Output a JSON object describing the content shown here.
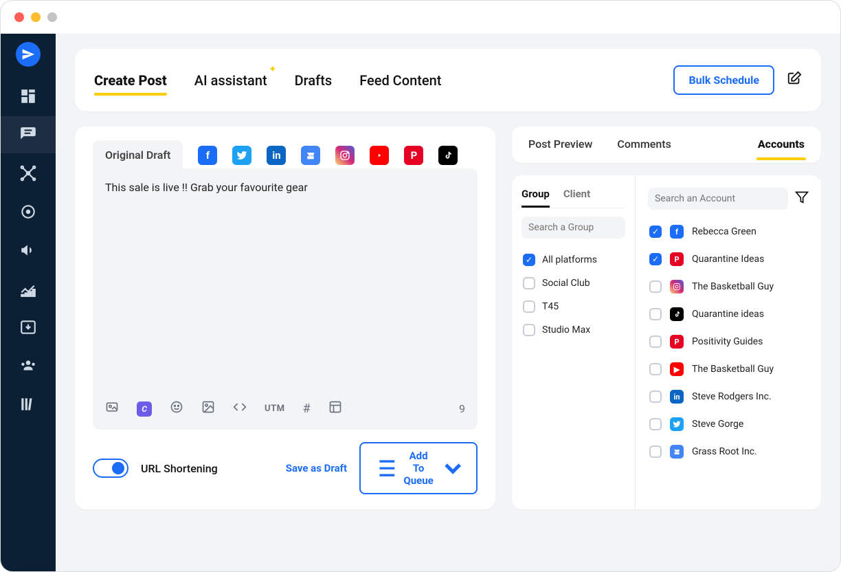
{
  "topTabs": {
    "create": "Create Post",
    "ai": "AI assistant",
    "drafts": "Drafts",
    "feed": "Feed Content"
  },
  "bulkSchedule": "Bulk Schedule",
  "editor": {
    "draftTab": "Original Draft",
    "text": "This sale is live !! Grab your favourite gear",
    "charCount": "9",
    "utmLabel": "UTM",
    "urlShortening": "URL Shortening",
    "saveDraft": "Save as Draft",
    "addToQueue": "Add To Queue"
  },
  "rightTabs": {
    "preview": "Post Preview",
    "comments": "Comments",
    "accounts": "Accounts"
  },
  "groupClient": {
    "group": "Group",
    "client": "Client"
  },
  "searchGroupPlaceholder": "Search a Group",
  "searchAccountPlaceholder": "Search an Account",
  "groups": [
    {
      "label": "All platforms",
      "checked": true
    },
    {
      "label": "Social Club",
      "checked": false
    },
    {
      "label": "T45",
      "checked": false
    },
    {
      "label": "Studio Max",
      "checked": false
    }
  ],
  "accounts": [
    {
      "name": "Rebecca Green",
      "net": "fb",
      "checked": true
    },
    {
      "name": "Quarantine Ideas",
      "net": "pn",
      "checked": true
    },
    {
      "name": "The Basketball Guy",
      "net": "ig",
      "checked": false
    },
    {
      "name": "Quarantine ideas",
      "net": "tt",
      "checked": false
    },
    {
      "name": "Positivity Guides",
      "net": "pn",
      "checked": false
    },
    {
      "name": "The Basketball Guy",
      "net": "yt",
      "checked": false
    },
    {
      "name": "Steve Rodgers Inc.",
      "net": "li",
      "checked": false
    },
    {
      "name": "Steve Gorge",
      "net": "tw",
      "checked": false
    },
    {
      "name": "Grass Root Inc.",
      "net": "gb",
      "checked": false
    }
  ]
}
